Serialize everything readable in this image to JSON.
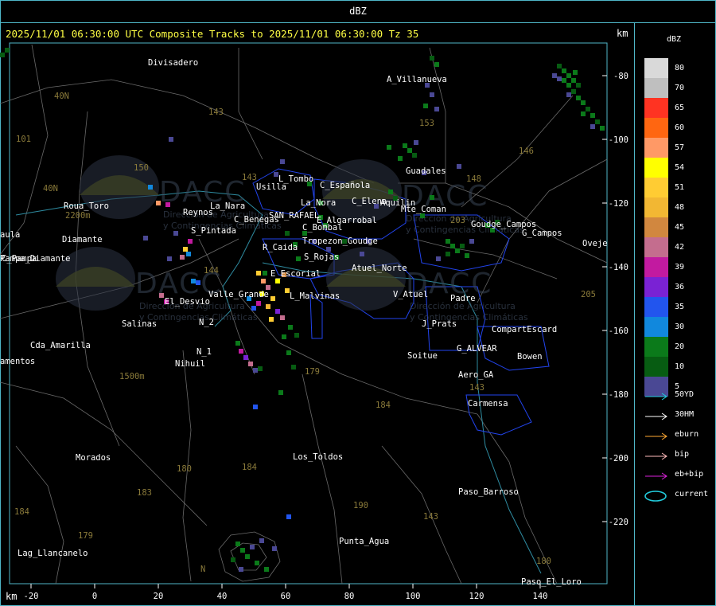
{
  "window": {
    "title": "dBZ"
  },
  "header": {
    "text": "2025/11/01 06:30:00 UTC Composite Tracks to 2025/11/01 06:30:00 Tz 35",
    "units_top": "km",
    "units_bottom": "km"
  },
  "axes": {
    "x_ticks": [
      "-20",
      "0",
      "20",
      "40",
      "60",
      "80",
      "100",
      "120",
      "140"
    ],
    "y_ticks": [
      "-80",
      "-100",
      "-120",
      "-140",
      "-160",
      "-180",
      "-200",
      "-220"
    ]
  },
  "places": [
    "Divisadero",
    "A_Villanueva",
    "Guadales",
    "L_Tombo",
    "Usilla",
    "C_Española",
    "La_Nora",
    "C_Elena",
    "Aquilin",
    "Roua_Toro",
    "Reynos",
    "La_Nara",
    "C_Benegas",
    "SAN_RAFAEL",
    "E_Algarrobal",
    "C_Bombal",
    "Pampa_Diamante",
    "S_Pintada",
    "R_Caida",
    "Tropezon_Goudge",
    "S_Rojas",
    "Atuel_Norte",
    "E_Escorial",
    "Valle_Grande",
    "L_Malvinas",
    "El_Desvio",
    "V_Atuel",
    "J_Prats",
    "CompartEscard",
    "N_2",
    "N_1",
    "Nihuil",
    "Salinas",
    "Cda_Amarilla",
    "amentos",
    "Soitue",
    "G_ALVEAR",
    "Bowen",
    "Aero_GA",
    "Carmensa",
    "Morados",
    "Los_Toldos",
    "Paso_Barroso",
    "Punta_Agua",
    "Lag_Llancanelo",
    "Paso_El_Loro",
    "Goudge_Campos",
    "G_Campos",
    "Oveje",
    "aula",
    "Padre",
    "Mte_Coman",
    "Diamante",
    "C_Pampa"
  ],
  "route_numbers": [
    "40N",
    "143",
    "101",
    "150",
    "40N",
    "153",
    "146",
    "148",
    "203",
    "205",
    "144",
    "143",
    "179",
    "184",
    "180",
    "184",
    "183",
    "184",
    "179",
    "190",
    "143",
    "143",
    "180",
    "1500m",
    "2200m",
    "N"
  ],
  "watermark": {
    "brand": "DACC",
    "line1": "Dirección de Agricultura",
    "line2": "y Contingencias Climáticas"
  },
  "color_scale": {
    "title": "dBZ",
    "levels": [
      {
        "value": "80",
        "color": "#d9d9d9"
      },
      {
        "value": "70",
        "color": "#bfbfbf"
      },
      {
        "value": "65",
        "color": "#ff3322"
      },
      {
        "value": "60",
        "color": "#ff6611"
      },
      {
        "value": "57",
        "color": "#ff9966"
      },
      {
        "value": "54",
        "color": "#ffff00"
      },
      {
        "value": "51",
        "color": "#ffcc33"
      },
      {
        "value": "48",
        "color": "#f2b733"
      },
      {
        "value": "45",
        "color": "#d1873f"
      },
      {
        "value": "42",
        "color": "#c46d8e"
      },
      {
        "value": "39",
        "color": "#c21aa0"
      },
      {
        "value": "36",
        "color": "#7a22d4"
      },
      {
        "value": "35",
        "color": "#2255ee"
      },
      {
        "value": "30",
        "color": "#1188dd"
      },
      {
        "value": "20",
        "color": "#0b7a1a"
      },
      {
        "value": "10",
        "color": "#075c12"
      },
      {
        "value": "5",
        "color": "#4a4894"
      }
    ]
  },
  "tracks": [
    {
      "label": "50YD",
      "color": "#22ccdd",
      "kind": "arrow"
    },
    {
      "label": "30HM",
      "color": "#ffffff",
      "kind": "arrow"
    },
    {
      "label": "eburn",
      "color": "#ffaa33",
      "kind": "arrow"
    },
    {
      "label": "bip",
      "color": "#ffbbbb",
      "kind": "arrow"
    },
    {
      "label": "eb+bip",
      "color": "#dd22dd",
      "kind": "arrow"
    },
    {
      "label": "current",
      "color": "#22ccdd",
      "kind": "ellipse"
    }
  ]
}
